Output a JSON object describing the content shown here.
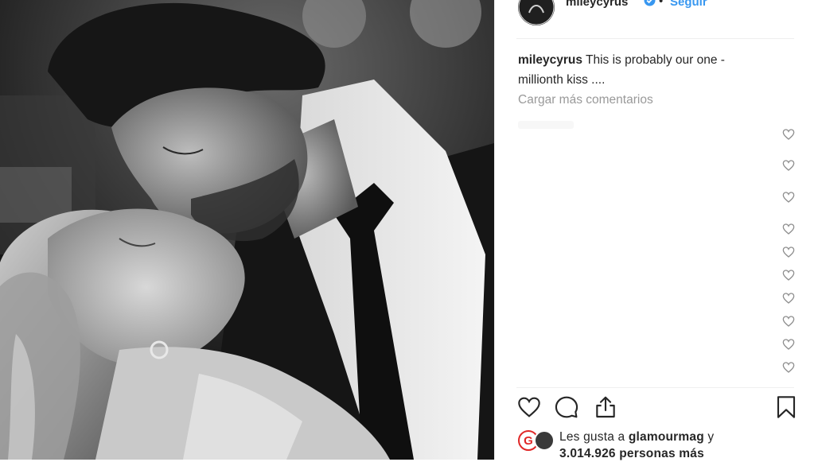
{
  "post": {
    "username": "mileycyrus",
    "follow_label": "Seguir",
    "dot": "•",
    "caption_user": "mileycyrus",
    "caption_text": " This is probably our one -",
    "caption_text_2": "millionth kiss ....",
    "load_more": "Cargar más comentarios",
    "likes_prefix": "Les gusta a ",
    "likes_user": "glamourmag",
    "likes_mid": " y",
    "likes_count": "3.014.926 personas más",
    "likes_avatar_letter": "G"
  },
  "icons": {
    "verified": "verified-badge-icon",
    "like": "heart-icon",
    "comment": "comment-icon",
    "share": "share-icon",
    "save": "bookmark-icon"
  },
  "colors": {
    "link": "#3897f0",
    "text": "#262626",
    "muted": "#999999"
  }
}
